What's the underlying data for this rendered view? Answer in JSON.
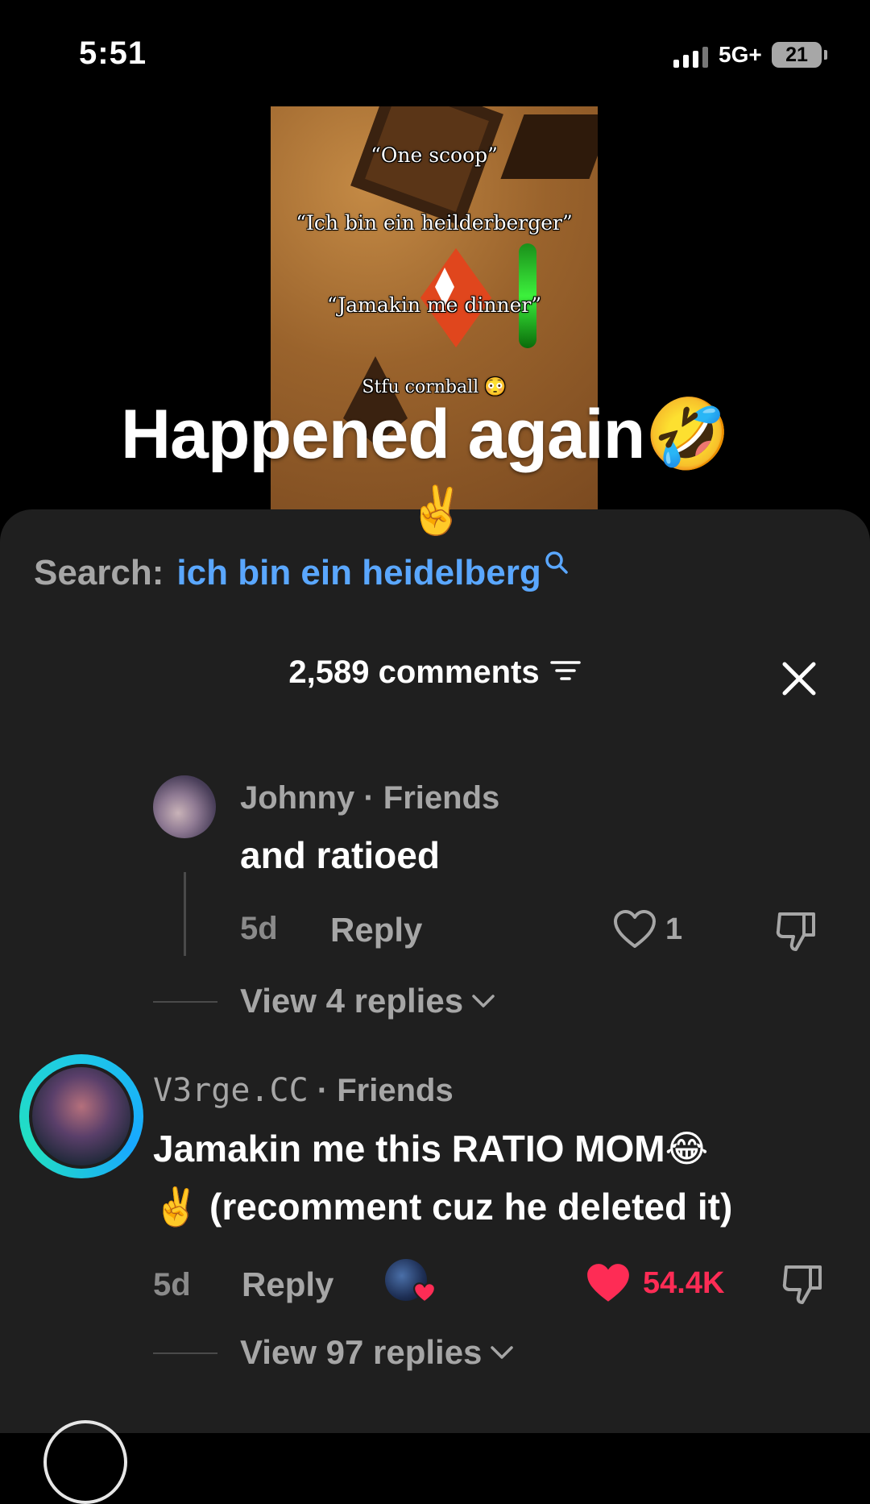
{
  "status_bar": {
    "time": "5:51",
    "network": "5G+",
    "battery": "21"
  },
  "video": {
    "captions": [
      "“One scoop”",
      "“Ich bin ein heilderberger”",
      "“Jamakin me dinner”",
      "Stfu cornball 😳"
    ],
    "overlay_title": "Happened again🤣",
    "overlay_emoji": "✌️"
  },
  "search": {
    "label": "Search:",
    "query": "ich bin ein heidelberg"
  },
  "comments_header": {
    "count_label": "2,589 comments"
  },
  "comments": [
    {
      "username": "Johnny",
      "relation": "· Friends",
      "text": "and ratioed",
      "age": "5d",
      "reply_label": "Reply",
      "likes": "1",
      "view_replies": "View 4 replies"
    },
    {
      "username": "V3rge.CC",
      "relation": "· Friends",
      "text_line1": "Jamakin me this RATIO MOM😂",
      "text_line2": "✌️  (recomment cuz he deleted it)",
      "age": "5d",
      "reply_label": "Reply",
      "likes": "54.4K",
      "view_replies": "View 97 replies"
    }
  ],
  "colors": {
    "accent_link": "#5aa7ff",
    "like_red": "#fe2c55",
    "sheet_bg": "#1f1f1f"
  }
}
